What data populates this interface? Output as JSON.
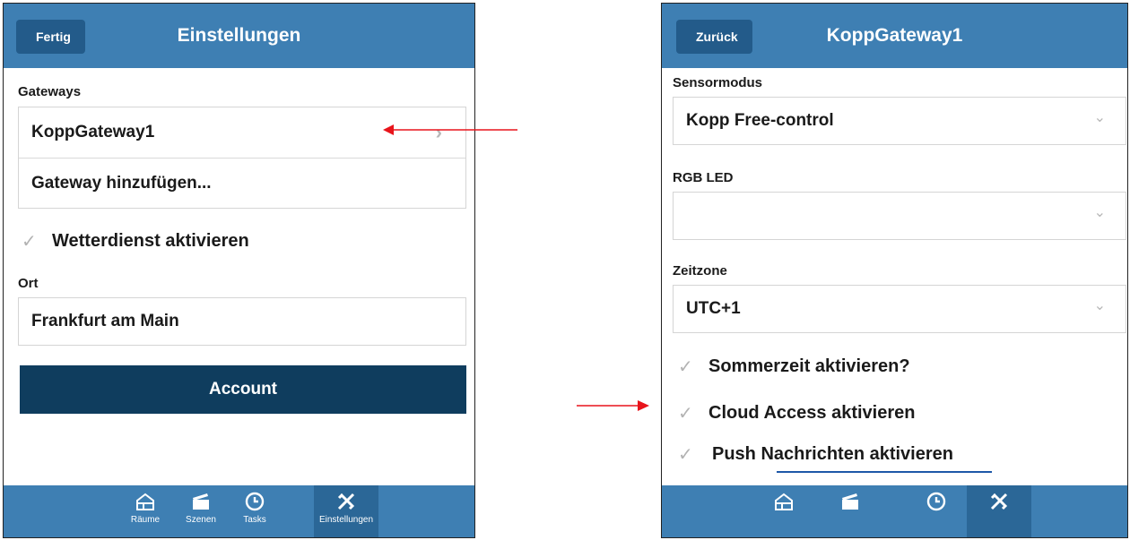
{
  "left_screen": {
    "header": {
      "back_label": "Fertig",
      "title": "Einstellungen"
    },
    "gateways_label": "Gateways",
    "gateway_items": [
      "KoppGateway1",
      "Gateway hinzufügen..."
    ],
    "weather": {
      "label": "Wetterdienst aktivieren",
      "checked": true
    },
    "location_label": "Ort",
    "location_value": "Frankfurt am Main",
    "account_label": "Account",
    "tabs": [
      {
        "label": "Räume",
        "icon": "house-icon"
      },
      {
        "label": "Szenen",
        "icon": "clapperboard-icon"
      },
      {
        "label": "Tasks",
        "icon": "clock-icon"
      },
      {
        "label": "Einstellungen",
        "icon": "tools-icon",
        "active": true
      }
    ]
  },
  "right_screen": {
    "header": {
      "back_label": "Zurück",
      "title": "KoppGateway1"
    },
    "sensor_mode_label": "Sensormodus",
    "sensor_mode_value": "Kopp Free-control",
    "rgb_led_label": "RGB LED",
    "rgb_led_value": "",
    "timezone_label": "Zeitzone",
    "timezone_value": "UTC+1",
    "checkboxes": [
      {
        "label": "Sommerzeit aktivieren?",
        "checked": true
      },
      {
        "label": "Cloud Access aktivieren",
        "checked": true
      },
      {
        "label": "Push Nachrichten aktivieren",
        "checked": true
      }
    ],
    "tab_icons": [
      "house-icon",
      "clapperboard-icon",
      "clock-icon",
      "tools-icon"
    ]
  },
  "annotation_color": "#e8141b",
  "header_color": "#3e7fb3",
  "account_button_color": "#0f3d5e"
}
